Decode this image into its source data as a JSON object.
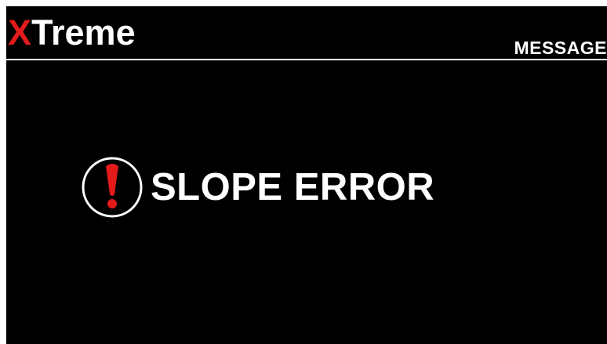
{
  "brand": {
    "accent_letter": "X",
    "rest": "Treme"
  },
  "header": {
    "title": "MESSAGE"
  },
  "message": {
    "icon": "exclamation-circle-icon",
    "text": "SLOPE ERROR"
  },
  "colors": {
    "background": "#000000",
    "foreground": "#ffffff",
    "accent": "#e31b1b"
  }
}
